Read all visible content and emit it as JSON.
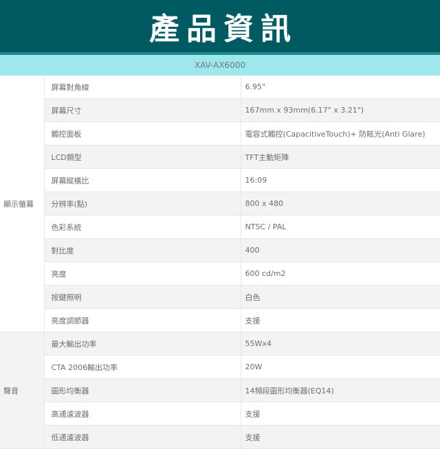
{
  "header": {
    "title": "產品資訊"
  },
  "model": "XAV-AX6000",
  "groups": [
    {
      "name": "顯示螢幕",
      "rows": [
        {
          "label": "屏幕對角線",
          "value": "6.95\""
        },
        {
          "label": "屏幕尺寸",
          "value": "167mm x 93mm(6.17\" x 3.21\")"
        },
        {
          "label": "觸控面板",
          "value": "電容式觸控(CapacitiveTouch)+ 防眩光(Anti Glare)"
        },
        {
          "label": "LCD類型",
          "value": "TFT主動矩陣"
        },
        {
          "label": "屏幕縱橫比",
          "value": "16:09"
        },
        {
          "label": "分辨率(點)",
          "value": "800 x 480"
        },
        {
          "label": "色彩系統",
          "value": "NTSC / PAL"
        },
        {
          "label": "對比度",
          "value": "400"
        },
        {
          "label": "亮度",
          "value": "600 cd/m2"
        },
        {
          "label": "按鍵照明",
          "value": "白色"
        },
        {
          "label": "亮度調節器",
          "value": "支援"
        }
      ]
    },
    {
      "name": "聲音",
      "rows": [
        {
          "label": "最大輸出功率",
          "value": "55Wx4"
        },
        {
          "label": "CTA 2006輸出功率",
          "value": "20W"
        },
        {
          "label": "圖形均衡器",
          "value": "14頻段圖形均衡器(EQ14)"
        },
        {
          "label": "高通濾波器",
          "value": "支援"
        },
        {
          "label": "低通濾波器",
          "value": "支援"
        }
      ]
    }
  ]
}
